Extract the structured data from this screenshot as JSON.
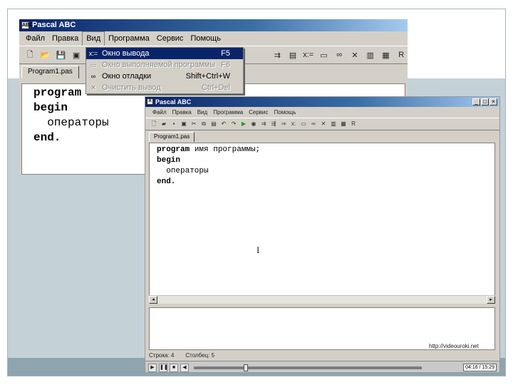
{
  "colors": {
    "band": "#c4d1d7",
    "footer": "#8ea4ae",
    "titlebar": "#0a246a",
    "highlight": "#0a246a"
  },
  "window1": {
    "title": "Pascal ABC",
    "menu": [
      "Файл",
      "Правка",
      "Вид",
      "Программа",
      "Сервис",
      "Помощь"
    ],
    "tab": "Program1.pas",
    "code": [
      "program",
      "begin",
      "  операторы",
      "end."
    ]
  },
  "dropdown": {
    "items": [
      {
        "icon": "output-window-icon",
        "glyph": "x:=",
        "label": "Окно вывода",
        "shortcut": "F5"
      },
      {
        "icon": "run-window-icon",
        "glyph": "▭",
        "label": "Окно выполняемой программы",
        "shortcut": "F6"
      },
      {
        "icon": "debug-window-icon",
        "glyph": "∞",
        "label": "Окно отладки",
        "shortcut": "Shift+Ctrl+W"
      },
      {
        "icon": "clear-output-icon",
        "glyph": "✕",
        "label": "Очистить вывод",
        "shortcut": "Ctrl+Del"
      }
    ]
  },
  "window2": {
    "title": "Pascal ABC",
    "menu": [
      "Файл",
      "Правка",
      "Вид",
      "Программа",
      "Сервис",
      "Помощь"
    ],
    "tab": "Program1.pas",
    "code_keyword": "program",
    "code_name": " имя программы;",
    "code_rest": [
      "begin",
      "  операторы",
      "end."
    ],
    "status_line": "Строка: 4",
    "status_col": "Столбец: 5",
    "watermark": "http://videouroki.net",
    "player_time": "04:16 / 15:29",
    "player_progress": 0.22
  }
}
